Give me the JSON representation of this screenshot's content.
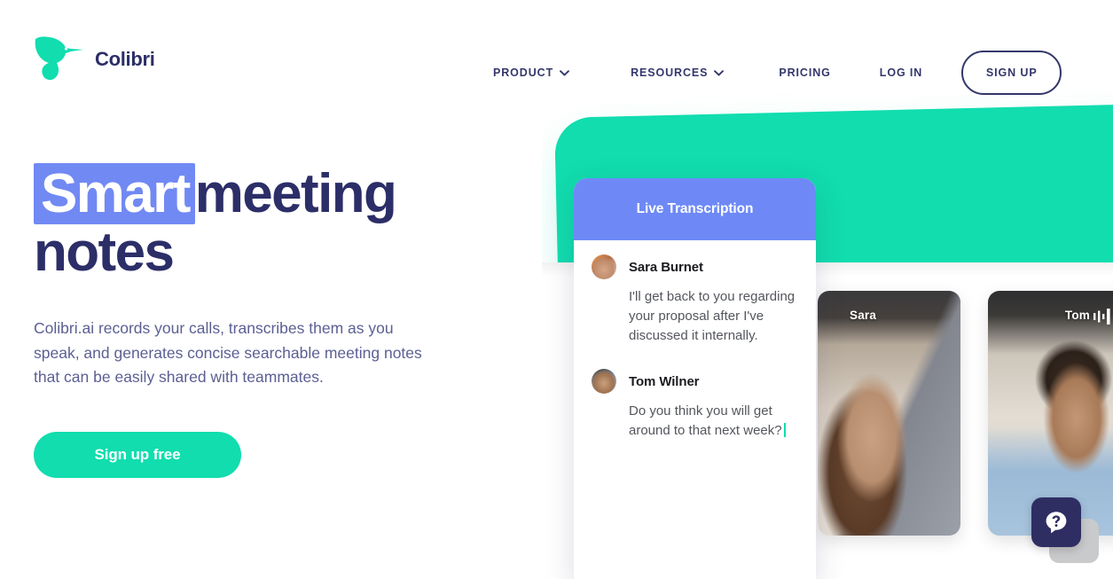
{
  "brand": {
    "name": "Colibri",
    "logo_icon": "hummingbird-logo-icon",
    "logo_color": "#11ddae",
    "text_color": "#2c2e68"
  },
  "nav": {
    "items": [
      {
        "label": "PRODUCT",
        "has_dropdown": true,
        "icon": "chevron-down-icon"
      },
      {
        "label": "RESOURCES",
        "has_dropdown": true,
        "icon": "chevron-down-icon"
      },
      {
        "label": "PRICING",
        "has_dropdown": false,
        "icon": ""
      },
      {
        "label": "LOG IN",
        "has_dropdown": false,
        "icon": ""
      }
    ],
    "signup_label": "SIGN UP"
  },
  "hero": {
    "title_highlight": "Smart",
    "title_rest": "meeting",
    "title_line2": "notes",
    "highlight_color": "#7189f3",
    "subtitle": "Colibri.ai records your calls, transcribes them as you speak, and generates concise searchable meeting notes that can be easily shared with teammates.",
    "cta_label": "Sign up free",
    "cta_color": "#11ddae"
  },
  "transcript": {
    "header_title": "Live Transcription",
    "header_color": "#6e89f6",
    "messages": [
      {
        "avatar": "avatar-sara",
        "name": "Sara Burnet",
        "text": "I'll get back to you regarding your proposal after I've discussed it internally."
      },
      {
        "avatar": "avatar-tom",
        "name": "Tom Wilner",
        "text": "Do you think you will get around to that next week?"
      }
    ],
    "cursor_color": "#11ddae"
  },
  "video_tiles": [
    {
      "name": "Sara",
      "audio_active": false,
      "audio_icon": ""
    },
    {
      "name": "Tom",
      "audio_active": true,
      "audio_icon": "audio-waveform-icon"
    }
  ],
  "help_widget": {
    "icon": "question-mark-chat-icon",
    "bg_color": "#2e2e63"
  },
  "panel": {
    "accent_color": "#11ddae"
  }
}
